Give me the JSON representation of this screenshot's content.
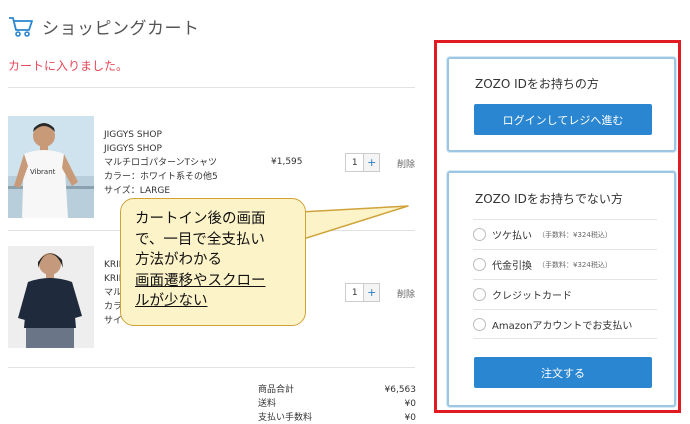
{
  "header": {
    "title": "ショッピングカート",
    "icon": "cart-icon"
  },
  "notice": "カートに入りました。",
  "items": [
    {
      "lines": [
        "JIGGYS SHOP",
        "JIGGYS SHOP",
        "マルチロゴパターンTシャツ",
        "カラー：ホワイト系その他5",
        "サイズ：LARGE"
      ],
      "price": "¥1,595",
      "qty": "1",
      "plus": "+",
      "delete": "削除"
    },
    {
      "lines": [
        "KRIF",
        "KRIF",
        "マル",
        "カラ",
        "サイ"
      ],
      "price": "",
      "qty": "1",
      "plus": "+",
      "delete": "削除"
    }
  ],
  "summary": [
    {
      "label": "商品合計",
      "value": "¥6,563"
    },
    {
      "label": "送料",
      "value": "¥0"
    },
    {
      "label": "支払い手数料",
      "value": "¥0"
    }
  ],
  "callout": {
    "line1": "カートイン後の画面",
    "line2": "で、一目で全支払い",
    "line3": "方法がわかる",
    "line4": "画面遷移やスクロー",
    "line5": "ルが少ない"
  },
  "login_card": {
    "title": "ZOZO IDをお持ちの方",
    "button": "ログインしてレジへ進む"
  },
  "guest_card": {
    "title": "ZOZO IDをお持ちでない方",
    "options": [
      {
        "label": "ツケ払い",
        "fee": "（手数料：¥324税込）"
      },
      {
        "label": "代金引換",
        "fee": "（手数料：¥324税込）"
      },
      {
        "label": "クレジットカード",
        "fee": ""
      },
      {
        "label": "Amazonアカウントでお支払い",
        "fee": ""
      }
    ],
    "button": "注文する"
  },
  "colors": {
    "accent": "#2a86d1",
    "highlight_frame": "#e21b23",
    "notice": "#e8485a",
    "callout_bg": "#fdf3c8"
  }
}
